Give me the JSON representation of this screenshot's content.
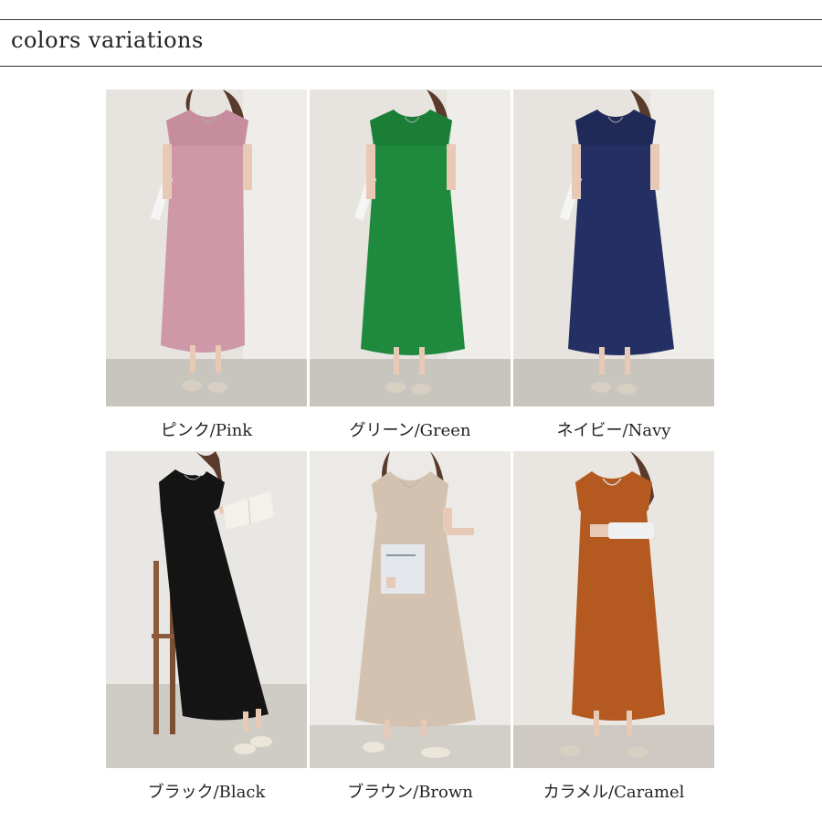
{
  "header": {
    "title": "colors variations"
  },
  "variants": [
    {
      "label": "ピンク/Pink",
      "color": "#cf98a8",
      "pose": "book-left"
    },
    {
      "label": "グリーン/Green",
      "color": "#1f8a3e",
      "pose": "book-left"
    },
    {
      "label": "ネイビー/Navy",
      "color": "#243064",
      "pose": "book-left"
    },
    {
      "label": "ブラック/Black",
      "color": "#141414",
      "pose": "reading"
    },
    {
      "label": "ブラウン/Brown",
      "color": "#d4c2b0",
      "pose": "magazine"
    },
    {
      "label": "カラメル/Caramel",
      "color": "#b45a20",
      "pose": "clutch"
    }
  ]
}
